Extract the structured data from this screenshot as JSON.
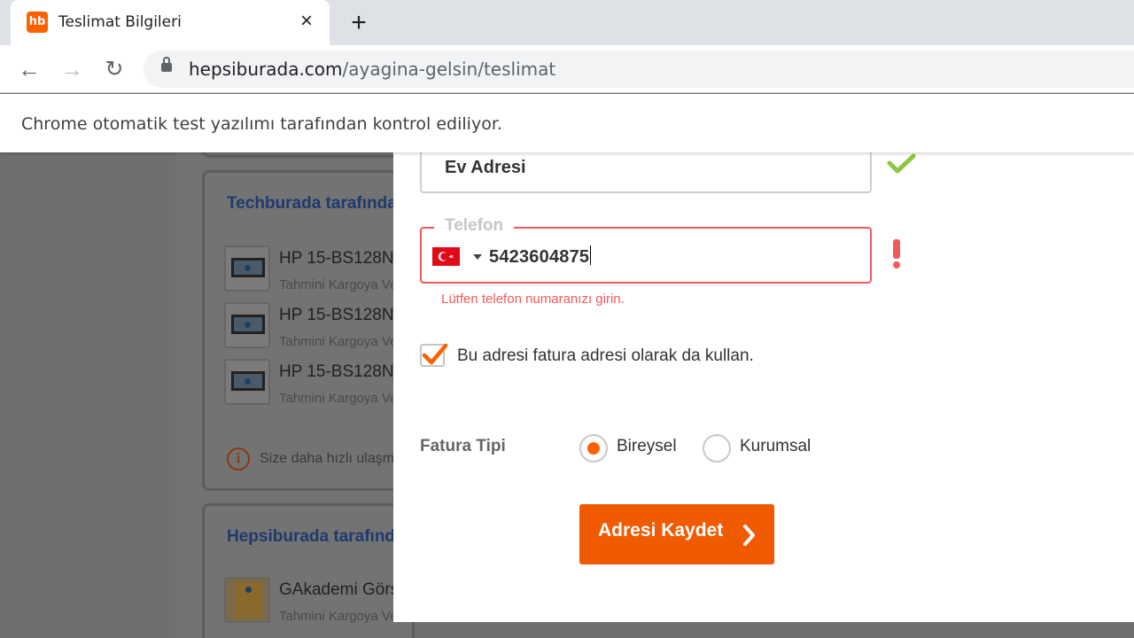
{
  "browser": {
    "tab_title": "Teslimat Bilgileri",
    "favicon_text": "hb",
    "url_host": "hepsiburada.com",
    "url_path": "/ayagina-gelsin/teslimat",
    "infobar_text": "Chrome otomatik test yazılımı tarafından kontrol ediliyor."
  },
  "background": {
    "seller_1": "Techburada tarafından",
    "items": [
      {
        "title": "HP 15-BS128N",
        "sub": "Tahmini Kargoya Veriliş"
      },
      {
        "title": "HP 15-BS128N",
        "sub": "Tahmini Kargoya Veriliş"
      },
      {
        "title": "HP 15-BS128N",
        "sub": "Tahmini Kargoya Veriliş"
      }
    ],
    "info_text": "Size daha hızlı ulaşması",
    "seller_2": "Hepsiburada tarafından",
    "item_4": {
      "title": "GAkademi Görsel",
      "sub": "Tahmini Kargoya Veriliş"
    }
  },
  "form": {
    "address_name_value": "Ev Adresi",
    "phone_label": "Telefon",
    "phone_value": "5423604875",
    "phone_error": "Lütfen telefon numaranızı girin.",
    "billing_same_label": "Bu adresi fatura adresi olarak da kullan.",
    "billing_same_checked": true,
    "invoice_type_label": "Fatura Tipi",
    "invoice_options": [
      "Bireysel",
      "Kurumsal"
    ],
    "invoice_selected": "Bireysel",
    "save_button": "Adresi Kaydet"
  },
  "colors": {
    "brand_orange": "#ff6000",
    "button_orange": "#f05a00",
    "error_red": "#f15a5a",
    "success_green": "#8cc63f"
  }
}
